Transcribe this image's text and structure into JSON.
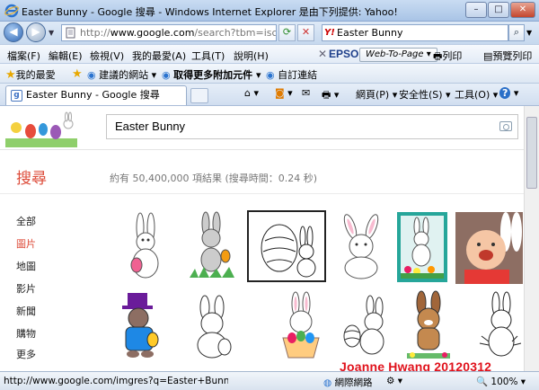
{
  "window": {
    "title": "Easter Bunny - Google 搜尋 - Windows Internet Explorer 是由下列提供: Yahoo!",
    "minimize": "–",
    "maximize": "□",
    "close": "✕"
  },
  "address_bar": {
    "url_prefix": "http://",
    "url_host": "www.google.com",
    "url_path": "/search?tbm=isch&hl",
    "refresh_icon": "refresh-icon",
    "stop_icon": "stop-icon",
    "search_value": "Easter Bunny",
    "search_provider": "Y!"
  },
  "menu": {
    "items": [
      "檔案(F)",
      "編輯(E)",
      "檢視(V)",
      "我的最愛(A)",
      "工具(T)",
      "說明(H)"
    ],
    "close_x": "✕",
    "epson": "EPSON",
    "web_to_page": "Web-To-Page ▾",
    "print": "列印",
    "preview": "預覽列印"
  },
  "favorites": {
    "favorites_label": "我的最愛",
    "suggested": "建議的網站 ▾",
    "addons": "取得更多附加元件 ▾",
    "custom_links": "自訂連結"
  },
  "tabs": {
    "active_tab": "Easter Bunny - Google 搜尋",
    "page_menu": "網頁(P) ▾",
    "safety_menu": "安全性(S) ▾",
    "tools_menu": "工具(O) ▾",
    "help_icon": "help-icon"
  },
  "google": {
    "search_value": "Easter Bunny",
    "section_title": "搜尋",
    "stats": "約有 50,400,000 項結果 (搜尋時間：0.24 秒)",
    "left_nav": [
      "全部",
      "圖片",
      "地圖",
      "影片",
      "新聞",
      "購物",
      "更多"
    ],
    "active_nav": "圖片",
    "image_results_row1": [
      "bunny-with-egg",
      "bunny-in-grass",
      "coloring-egg-bunny",
      "white-bunny-sitting",
      "bunny-garden-flag",
      "baby-in-bunny-ears"
    ],
    "image_results_row2": [
      "bunny-top-hat",
      "bunny-outline",
      "bunny-egg-basket",
      "bunny-with-egg-outline",
      "brown-bunny-cartoon",
      "bunny-lineart"
    ]
  },
  "status_bar": {
    "url": "http://www.google.com/imgres?q=Easter+Bunny&hl=",
    "zone": "網際網路",
    "zoom": "100%"
  },
  "watermark": "Joanne Hwang 20120312",
  "colors": {
    "google_red": "#dd4b39",
    "watermark_red": "#e0111b",
    "ie_chrome_blue": "#c6d8ee"
  }
}
